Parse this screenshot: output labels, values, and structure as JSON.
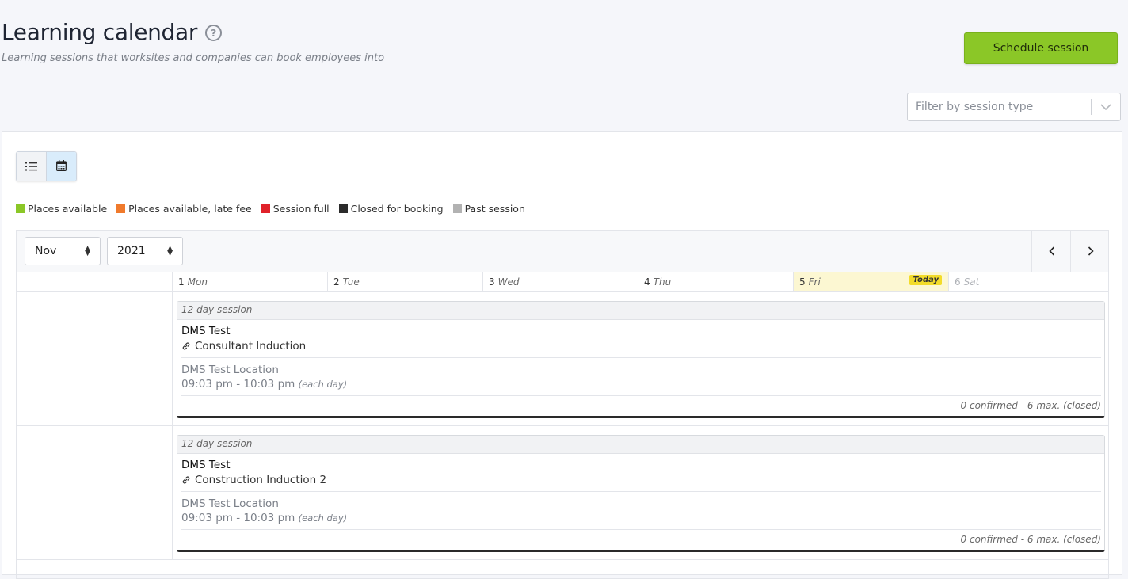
{
  "header": {
    "title": "Learning calendar",
    "subtitle": "Learning sessions that worksites and companies can book employees into",
    "help_icon": "question-circle-icon",
    "schedule_button": "Schedule session",
    "filter_placeholder": "Filter by session type"
  },
  "colors": {
    "accent_green": "#8bc727",
    "today_highlight": "#fcf7d2",
    "today_badge": "#f3dc2a"
  },
  "legend": [
    {
      "label": "Places available",
      "color": "#8bc727"
    },
    {
      "label": "Places available, late fee",
      "color": "#f07a2c"
    },
    {
      "label": "Session full",
      "color": "#e0222a"
    },
    {
      "label": "Closed for booking",
      "color": "#2b2b2b"
    },
    {
      "label": "Past session",
      "color": "#b2b2b2"
    }
  ],
  "calendar": {
    "month": "Nov",
    "year": "2021",
    "days": [
      {
        "num": "1",
        "name": "Mon"
      },
      {
        "num": "2",
        "name": "Tue"
      },
      {
        "num": "3",
        "name": "Wed"
      },
      {
        "num": "4",
        "name": "Thu"
      },
      {
        "num": "5",
        "name": "Fri",
        "badge": "Today"
      },
      {
        "num": "6",
        "name": "Sat"
      }
    ],
    "sessions": [
      {
        "header": "12 day session",
        "title": "DMS Test",
        "course": "Consultant Induction",
        "location": "DMS Test Location",
        "time": "09:03 pm - 10:03 pm",
        "time_note": "(each day)",
        "count": "0 confirmed - 6 max. (closed)"
      },
      {
        "header": "12 day session",
        "title": "DMS Test",
        "course": "Construction Induction 2",
        "location": "DMS Test Location",
        "time": "09:03 pm - 10:03 pm",
        "time_note": "(each day)",
        "count": "0 confirmed - 6 max. (closed)"
      }
    ]
  }
}
